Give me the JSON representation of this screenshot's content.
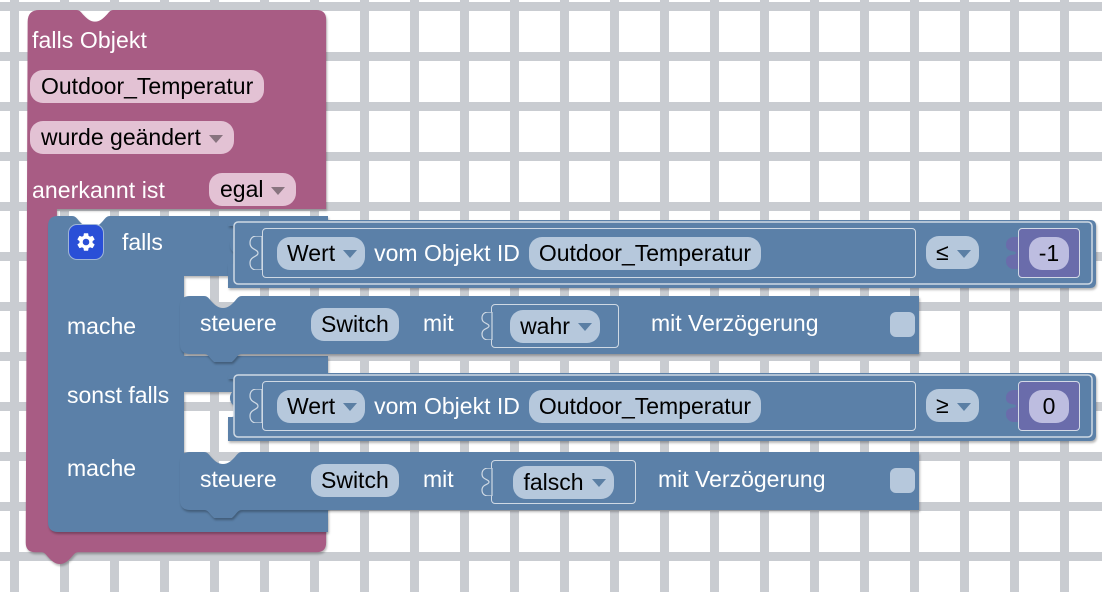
{
  "workspace": {
    "background_color": "#ffffff",
    "grid_mark_color": "#c9ccd1",
    "grid_spacing_px": 50
  },
  "colors": {
    "event_block": "#a85c84",
    "event_field": "#e3c2d4",
    "logic_block": "#5b80a8",
    "logic_field": "#b6c8dc",
    "math_block": "#6a6cab",
    "math_field": "#bdbde0",
    "mutator_button": "#2a4fd7",
    "block_outline": "#cfd9e4"
  },
  "event_block": {
    "name": "falls-objekt-trigger",
    "line1": "falls Objekt",
    "object_id": "Outdoor_Temperatur",
    "trigger_mode": "wurde geändert",
    "ack_label": "anerkannt ist",
    "ack_value": "egal"
  },
  "if_block": {
    "name": "controls-if",
    "mutator_icon": "gear-icon",
    "if_label": "falls",
    "do_label_1": "mache",
    "elseif_label": "sonst falls",
    "do_label_2": "mache"
  },
  "conditions": [
    {
      "get_value_selector": "Wert",
      "middle_label": "vom Objekt ID",
      "object_id": "Outdoor_Temperatur",
      "operator": "≤",
      "number": "-1"
    },
    {
      "get_value_selector": "Wert",
      "middle_label": "vom Objekt ID",
      "object_id": "Outdoor_Temperatur",
      "operator": "≥",
      "number": "0"
    }
  ],
  "actions": [
    {
      "verb": "steuere",
      "target": "Switch",
      "with_label": "mit",
      "value": "wahr",
      "delay_label": "mit Verzögerung",
      "delay_checked": false
    },
    {
      "verb": "steuere",
      "target": "Switch",
      "with_label": "mit",
      "value": "falsch",
      "delay_label": "mit Verzögerung",
      "delay_checked": false
    }
  ]
}
